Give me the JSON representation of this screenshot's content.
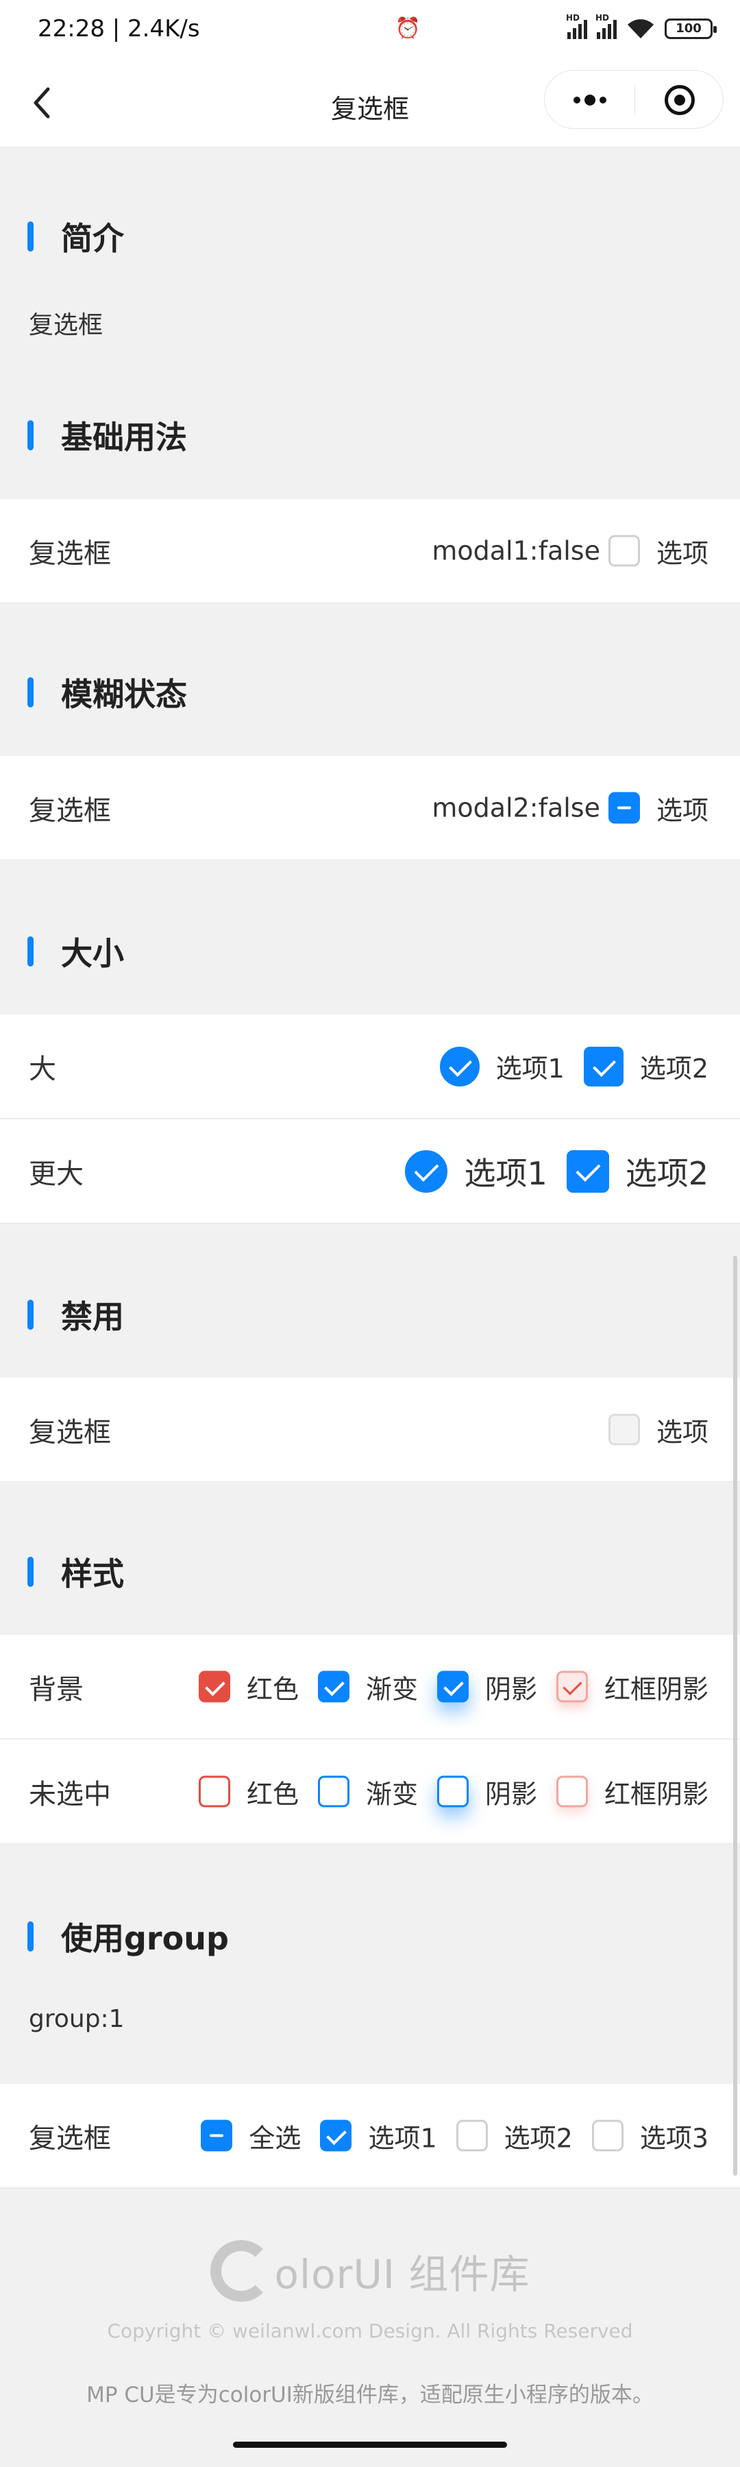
{
  "status_bar": {
    "time_speed": "22:28 | 2.4K/s",
    "battery": "100",
    "signal_label": "HD"
  },
  "navbar": {
    "title": "复选框"
  },
  "sections": {
    "intro": {
      "title": "简介",
      "text": "复选框"
    },
    "basic": {
      "title": "基础用法",
      "row_label": "复选框",
      "value": "modal1:false",
      "option": "选项"
    },
    "indeterminate": {
      "title": "模糊状态",
      "row_label": "复选框",
      "value": "modal2:false",
      "option": "选项"
    },
    "size": {
      "title": "大小",
      "rows": [
        {
          "label": "大",
          "opt1": "选项1",
          "opt2": "选项2"
        },
        {
          "label": "更大",
          "opt1": "选项1",
          "opt2": "选项2"
        }
      ]
    },
    "disabled": {
      "title": "禁用",
      "row_label": "复选框",
      "option": "选项"
    },
    "style": {
      "title": "样式",
      "rows": [
        {
          "label": "背景",
          "opts": [
            "红色",
            "渐变",
            "阴影",
            "红框阴影"
          ]
        },
        {
          "label": "未选中",
          "opts": [
            "红色",
            "渐变",
            "阴影",
            "红框阴影"
          ]
        }
      ]
    },
    "group": {
      "title": "使用group",
      "value_text": "group:1",
      "row_label": "复选框",
      "opts": [
        "全选",
        "选项1",
        "选项2",
        "选项3"
      ]
    }
  },
  "footer": {
    "logo_text": "olorUI 组件库",
    "copyright": "Copyright © weilanwl.com Design. All Rights Reserved",
    "note": "MP CU是专为colorUI新版组件库，适配原生小程序的版本。"
  },
  "colors": {
    "accent": "#0a84ff",
    "red": "#e54d42",
    "background": "#f1f1f1"
  }
}
